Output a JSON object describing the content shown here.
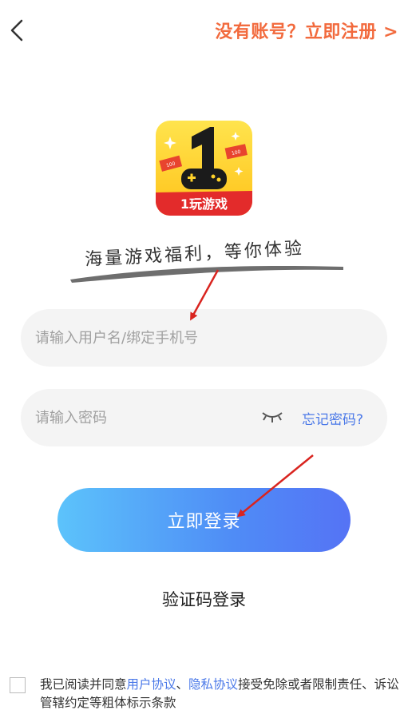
{
  "header": {
    "register_link": "没有账号？立即注册 >"
  },
  "logo": {
    "app_name": "1玩游戏",
    "digit": "1",
    "ticket_value": "100"
  },
  "slogan": "海量游戏福利，等你体验",
  "form": {
    "username_placeholder": "请输入用户名/绑定手机号",
    "password_placeholder": "请输入密码",
    "forgot_password": "忘记密码?",
    "login_button": "立即登录",
    "sms_login": "验证码登录"
  },
  "agreement": {
    "prefix": "我已阅读并同意",
    "user_agreement": "用户协议",
    "separator": "、",
    "privacy_agreement": "隐私协议",
    "suffix": "接受免除或者限制责任、诉讼管辖约定等粗体标示条款"
  },
  "colors": {
    "accent_orange": "#f26a3d",
    "link_blue": "#4a78e8",
    "button_gradient_start": "#5cc3fb",
    "button_gradient_end": "#5573f5",
    "annotation_arrow": "#d9241f"
  }
}
